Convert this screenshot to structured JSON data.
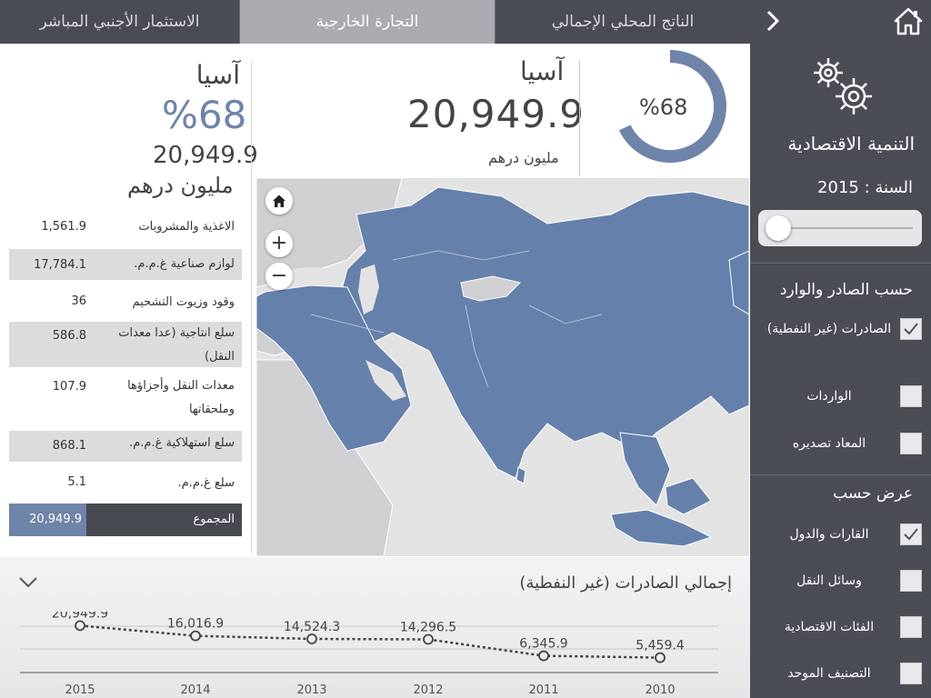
{
  "tabs": [
    {
      "label": "الاستثمار الأجنبي المباشر"
    },
    {
      "label": "التجارة الخارجية"
    },
    {
      "label": "الناتج المحلي الإجمالي"
    }
  ],
  "sidebar": {
    "title": "التنمية الاقتصادية",
    "year_label": "السنة : 2015",
    "section1": {
      "title": "حسب الصادر والوارد",
      "options": [
        {
          "label": "الصادرات (غير النفطية)",
          "checked": true
        },
        {
          "label": "الواردات",
          "checked": false
        },
        {
          "label": "المعاد تصديره",
          "checked": false
        }
      ]
    },
    "section2": {
      "title": "عرض حسب",
      "options": [
        {
          "label": "القارات والدول",
          "checked": true
        },
        {
          "label": "وسائل النقل",
          "checked": false
        },
        {
          "label": "الفئات الاقتصادية",
          "checked": false
        },
        {
          "label": "التصنيف الموحد",
          "checked": false
        }
      ]
    }
  },
  "summary": {
    "region": "آسيا",
    "percent": "%68",
    "value": "20,949.9",
    "unit": "مليون درهم",
    "unit_small": "مليون درهم",
    "donut_fraction": 0.68
  },
  "categories": [
    {
      "label": "الاغذية والمشروبات",
      "value": "1,561.9"
    },
    {
      "label": "لوازم صناعية غ.م.م.",
      "value": "17,784.1"
    },
    {
      "label": "وقود وزيوت التشحيم",
      "value": "36"
    },
    {
      "label": "سلع انتاجية (عدا معدات النقل)",
      "value": "586.8"
    },
    {
      "label": "معدات النقل وأجزاؤها وملحقاتها",
      "value": "107.9"
    },
    {
      "label": "سلع استهلاكية غ.م.م.",
      "value": "868.1"
    },
    {
      "label": "سلع غ.م.م.",
      "value": "5.1"
    }
  ],
  "total": {
    "label": "المجموع",
    "value": "20,949.9"
  },
  "map_controls": {
    "home": "home-icon",
    "zoom_in": "+",
    "zoom_out": "−"
  },
  "chart_title": "إجمالي الصادرات (غير النفطية)",
  "chart_data": {
    "type": "line",
    "x": [
      "2015",
      "2014",
      "2013",
      "2012",
      "2011",
      "2010"
    ],
    "values": [
      20949.9,
      16016.9,
      14524.3,
      14296.5,
      6345.9,
      5459.4
    ],
    "labels": [
      "20,949.9",
      "16,016.9",
      "14,524.3",
      "14,296.5",
      "6,345.9",
      "5,459.4"
    ],
    "title": "إجمالي الصادرات (غير النفطية)",
    "grid": true
  },
  "colors": {
    "accent": "#6e84a8",
    "dark": "#4a4c54",
    "map_land": "#6580ab",
    "map_other": "#d0d0d2"
  }
}
